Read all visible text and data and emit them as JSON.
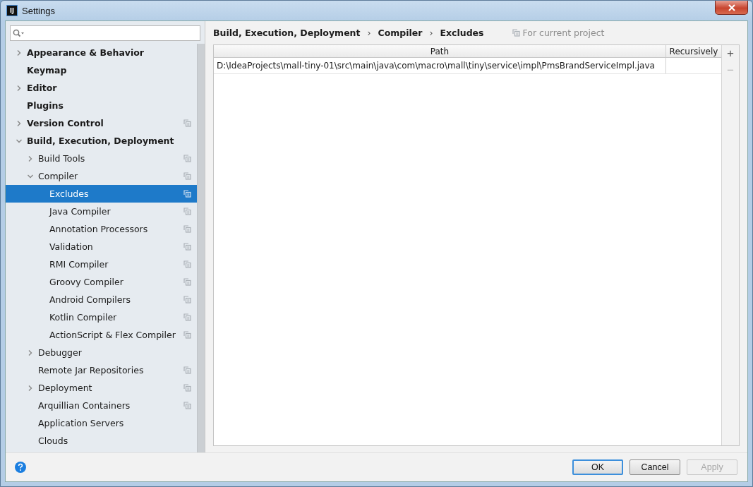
{
  "window": {
    "title": "Settings",
    "icon": "IJ"
  },
  "sidebar": {
    "items": [
      {
        "label": "Appearance & Behavior",
        "expanded": false,
        "project_scoped": false,
        "selected": false
      },
      {
        "label": "Keymap",
        "project_scoped": false,
        "selected": false
      },
      {
        "label": "Editor",
        "expanded": false,
        "project_scoped": false,
        "selected": false
      },
      {
        "label": "Plugins",
        "project_scoped": false,
        "selected": false
      },
      {
        "label": "Version Control",
        "expanded": false,
        "project_scoped": true,
        "selected": false
      },
      {
        "label": "Build, Execution, Deployment",
        "expanded": true,
        "project_scoped": false,
        "selected": false,
        "children": [
          {
            "label": "Build Tools",
            "expanded": false,
            "project_scoped": true,
            "selected": false
          },
          {
            "label": "Compiler",
            "expanded": true,
            "project_scoped": true,
            "selected": false,
            "children": [
              {
                "label": "Excludes",
                "project_scoped": true,
                "selected": true
              },
              {
                "label": "Java Compiler",
                "project_scoped": true,
                "selected": false
              },
              {
                "label": "Annotation Processors",
                "project_scoped": true,
                "selected": false
              },
              {
                "label": "Validation",
                "project_scoped": true,
                "selected": false
              },
              {
                "label": "RMI Compiler",
                "project_scoped": true,
                "selected": false
              },
              {
                "label": "Groovy Compiler",
                "project_scoped": true,
                "selected": false
              },
              {
                "label": "Android Compilers",
                "project_scoped": true,
                "selected": false
              },
              {
                "label": "Kotlin Compiler",
                "project_scoped": true,
                "selected": false
              },
              {
                "label": "ActionScript & Flex Compiler",
                "project_scoped": true,
                "selected": false
              }
            ]
          },
          {
            "label": "Debugger",
            "expanded": false,
            "project_scoped": false,
            "selected": false
          },
          {
            "label": "Remote Jar Repositories",
            "project_scoped": true,
            "selected": false
          },
          {
            "label": "Deployment",
            "expanded": false,
            "project_scoped": true,
            "selected": false
          },
          {
            "label": "Arquillian Containers",
            "project_scoped": true,
            "selected": false
          },
          {
            "label": "Application Servers",
            "project_scoped": false,
            "selected": false
          },
          {
            "label": "Clouds",
            "project_scoped": false,
            "selected": false
          }
        ]
      }
    ]
  },
  "breadcrumb": [
    "Build, Execution, Deployment",
    "Compiler",
    "Excludes"
  ],
  "breadcrumb_separator": "›",
  "scope_note": "For current project",
  "table": {
    "columns": [
      "Path",
      "Recursively"
    ],
    "rows": [
      {
        "path": "D:\\IdeaProjects\\mall-tiny-01\\src\\main\\java\\com\\macro\\mall\\tiny\\service\\impl\\PmsBrandServiceImpl.java",
        "recursively": false
      }
    ]
  },
  "table_tools": [
    "+",
    "−"
  ],
  "buttons": [
    {
      "label": "OK",
      "kind": "default",
      "disabled": false
    },
    {
      "label": "Cancel",
      "kind": "normal",
      "disabled": false
    },
    {
      "label": "Apply",
      "kind": "normal",
      "disabled": true
    }
  ]
}
